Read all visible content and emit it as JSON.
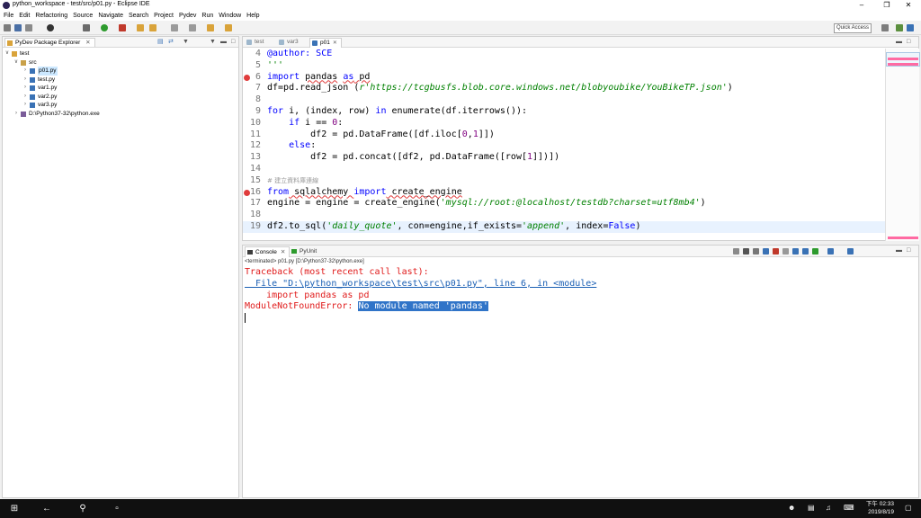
{
  "window": {
    "title": "python_workspace - test/src/p01.py - Eclipse IDE"
  },
  "menu": [
    "File",
    "Edit",
    "Refactoring",
    "Source",
    "Navigate",
    "Search",
    "Project",
    "Pydev",
    "Run",
    "Window",
    "Help"
  ],
  "toolbar": {
    "quick_access": "Quick Access"
  },
  "explorer": {
    "title": "PyDev Package Explorer",
    "tree": [
      {
        "label": "test",
        "level": 0,
        "arrow": "v",
        "icon": "project-icon"
      },
      {
        "label": "src",
        "level": 1,
        "arrow": "v",
        "icon": "package-folder-icon"
      },
      {
        "label": "p01.py",
        "level": 2,
        "arrow": ">",
        "icon": "python-file-icon",
        "selected": true
      },
      {
        "label": "test.py",
        "level": 2,
        "arrow": ">",
        "icon": "python-file-icon"
      },
      {
        "label": "var1.py",
        "level": 2,
        "arrow": ">",
        "icon": "python-file-icon"
      },
      {
        "label": "var2.py",
        "level": 2,
        "arrow": ">",
        "icon": "python-file-icon"
      },
      {
        "label": "var3.py",
        "level": 2,
        "arrow": ">",
        "icon": "python-file-icon"
      },
      {
        "label": "D:\\Python37-32\\python.exe",
        "level": 1,
        "arrow": ">",
        "icon": "interpreter-icon"
      }
    ]
  },
  "editor": {
    "tabs": [
      {
        "label": "test",
        "active": false
      },
      {
        "label": "var3",
        "active": false
      },
      {
        "label": "p01",
        "active": true
      }
    ],
    "lines": [
      {
        "n": "4",
        "marker": false,
        "current": false
      },
      {
        "n": "5",
        "marker": false,
        "current": false
      },
      {
        "n": "6",
        "marker": true,
        "current": false
      },
      {
        "n": "7",
        "marker": false,
        "current": false
      },
      {
        "n": "8",
        "marker": false,
        "current": false
      },
      {
        "n": "9",
        "marker": false,
        "current": false
      },
      {
        "n": "10",
        "marker": false,
        "current": false
      },
      {
        "n": "11",
        "marker": false,
        "current": false
      },
      {
        "n": "12",
        "marker": false,
        "current": false
      },
      {
        "n": "13",
        "marker": false,
        "current": false
      },
      {
        "n": "14",
        "marker": false,
        "current": false
      },
      {
        "n": "15",
        "marker": false,
        "current": false
      },
      {
        "n": "16",
        "marker": true,
        "current": false
      },
      {
        "n": "17",
        "marker": false,
        "current": false
      },
      {
        "n": "18",
        "marker": false,
        "current": false
      },
      {
        "n": "19",
        "marker": false,
        "current": true
      }
    ],
    "code": {
      "l4": [
        "@author: SCE"
      ],
      "l5": [
        "'''"
      ],
      "l6": [
        "import",
        " ",
        "pandas",
        " ",
        "as",
        " ",
        "pd"
      ],
      "l7": [
        "df=pd.read_json (",
        "r'https://tcgbusfs.blob.core.windows.net/blobyoubike/YouBikeTP.json'",
        ")"
      ],
      "l8": [
        ""
      ],
      "l9": [
        "for",
        " i, (index, row) ",
        "in",
        " enumerate(df.iterrows()):"
      ],
      "l10": [
        "    ",
        "if",
        " i == ",
        "0",
        ":"
      ],
      "l11": [
        "        df2 = pd.DataFrame([df.iloc[",
        "0",
        ",",
        "1",
        "]])"
      ],
      "l12": [
        "    ",
        "else",
        ":"
      ],
      "l13": [
        "        df2 = pd.concat([df2, pd.DataFrame([row[",
        "1",
        "]])])"
      ],
      "l14": [
        ""
      ],
      "l15": [
        "# 建立資料庫連線"
      ],
      "l16": [
        "from",
        " sqlalchemy ",
        "import",
        " create_engine"
      ],
      "l17": [
        "engine = engine = create_engine(",
        "'mysql://root:@localhost/testdb?charset=utf8mb4'",
        ")"
      ],
      "l18": [
        ""
      ],
      "l19": [
        "df2.to_sql(",
        "'daily_quote'",
        ", con=engine,if_exists=",
        "'append'",
        ", index=",
        "False",
        ")"
      ]
    }
  },
  "console": {
    "tabs": [
      {
        "label": "Console",
        "active": true
      },
      {
        "label": "PyUnit",
        "active": false
      }
    ],
    "status": "<terminated> p01.py [D:\\Python37-32\\python.exe]",
    "output": {
      "l1": "Traceback (most recent call last):",
      "l2": "  File \"D:\\python_workspace\\test\\src\\p01.py\", line 6, in <module>",
      "l3": "    import pandas as pd",
      "l4a": "ModuleNotFoundError: ",
      "l4b": "No module named 'pandas'"
    }
  },
  "taskbar": {
    "time": "下午 02:33",
    "date": "2019/8/19"
  },
  "colors": {
    "keyword": "#0000ff",
    "string": "#008000",
    "error": "#e01b1b",
    "link": "#1a5fb4",
    "selection": "#3074c8",
    "current_line": "#e8f2fe"
  }
}
